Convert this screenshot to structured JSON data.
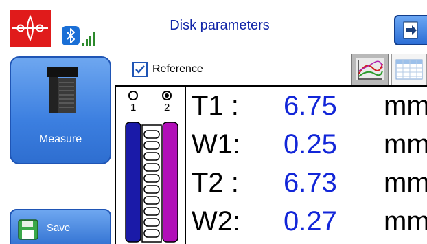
{
  "header": {
    "title": "Disk parameters"
  },
  "left_panel": {
    "measure_label": "Measure",
    "save_label": "Save"
  },
  "reference": {
    "label": "Reference",
    "checked": true
  },
  "disk_selector": {
    "options": [
      "1",
      "2"
    ],
    "selected": "2"
  },
  "measurements": [
    {
      "label": "T1 :",
      "value": "6.75",
      "unit": "mm"
    },
    {
      "label": "W1:",
      "value": "0.25",
      "unit": "mm"
    },
    {
      "label": "T2 :",
      "value": "6.73",
      "unit": "mm"
    },
    {
      "label": "W2:",
      "value": "0.27",
      "unit": "mm"
    }
  ],
  "colors": {
    "accent_blue": "#3c7fe0",
    "value_blue": "#1226d8",
    "logo_red": "#e01b1b",
    "disk_side_1": "#1a1aa8",
    "disk_side_2": "#b10fb8"
  },
  "icons": {
    "logo": "brand-logo-icon",
    "bluetooth": "bluetooth-icon",
    "signal": "signal-strength-icon",
    "exit": "exit-icon",
    "measure": "caliper-tool-icon",
    "save": "floppy-disk-icon",
    "chart_tab": "chart-icon",
    "table_tab": "table-icon"
  }
}
